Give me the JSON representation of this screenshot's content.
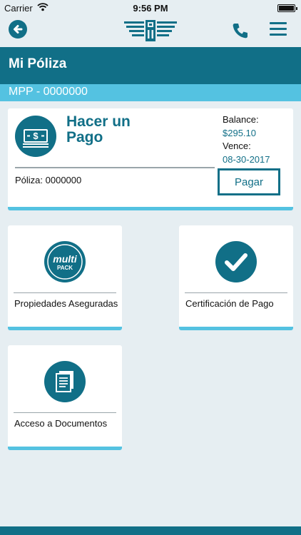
{
  "status_bar": {
    "carrier": "Carrier",
    "time": "9:56 PM"
  },
  "nav": {
    "back_icon": "back-arrow-icon",
    "logo_icon": "company-logo-icon",
    "phone_icon": "phone-icon",
    "menu_icon": "hamburger-menu-icon"
  },
  "header": {
    "title": "Mi Póliza",
    "policy_id": "MPP - 0000000"
  },
  "payment_card": {
    "title": "Hacer un Pago",
    "icon": "money-icon",
    "balance_label": "Balance:",
    "balance_value": "$295.10",
    "due_label": "Vence:",
    "due_value": "08-30-2017",
    "policy_text": "Póliza: 0000000",
    "pay_button_label": "Pagar"
  },
  "tiles": [
    {
      "label": "Propiedades Aseguradas",
      "icon": "multipack-icon",
      "icon_text_1": "multi",
      "icon_text_2": "PACK"
    },
    {
      "label": "Certificación de Pago",
      "icon": "checkmark-icon"
    },
    {
      "label": "Acceso a Documentos",
      "icon": "documents-icon"
    }
  ],
  "colors": {
    "primary": "#116f87",
    "accent": "#54c2e1",
    "background": "#e6eef2"
  }
}
